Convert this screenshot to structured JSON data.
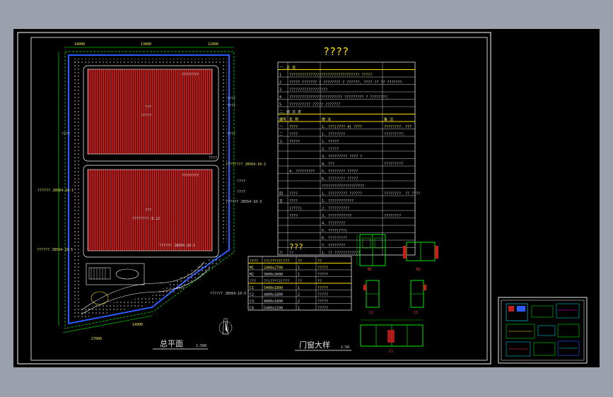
{
  "drawing": {
    "main_title": "????",
    "site_plan_title": "总平面",
    "site_plan_scale": "1:500",
    "door_title": "门窗大样",
    "door_scale": "1:50",
    "door_table_title": "???",
    "building1_label": "???",
    "building1_sub": "?????",
    "building2_label": "???",
    "building2_sub": "???????? 8.12",
    "building_tag": "????????",
    "ref_labels": [
      "????",
      "????",
      "????",
      "????",
      "????????  J8564-10-2",
      "????",
      "????",
      "?????? J8564-10-3",
      "?????? J8564-10-1",
      "????",
      "????",
      "?????? J8564-10-5",
      "?????? J8564-10-1",
      "?????? J8564-10-5"
    ],
    "top_dims": [
      "14000",
      "13000",
      "12000"
    ],
    "bottom_dims": [
      "27000",
      "14000"
    ]
  },
  "spec_table": {
    "rows": [
      {
        "c0": "一、总 说",
        "c1": "",
        "c2": "",
        "c3": ""
      },
      {
        "c0": "1",
        "c1": "????????????????????????????????? ?????",
        "c2": "",
        "c3": ""
      },
      {
        "c0": "2",
        "c1": "????? ??????? ? ???????? ? ??????, ???? ?? ?? ???????.",
        "c2": "",
        "c3": ""
      },
      {
        "c0": "3",
        "c1": "??????????????????",
        "c2": "",
        "c3": ""
      },
      {
        "c0": "4",
        "c1": "????????????????????????? ????????? ? ????????.",
        "c2": "",
        "c3": ""
      },
      {
        "c0": "5",
        "c1": "?????????? ????? ???????",
        "c2": "",
        "c3": ""
      },
      {
        "c0": "二、做 法 表",
        "c1": "",
        "c2": "",
        "c3": ""
      },
      {
        "c0": "编号",
        "c1": "名 称",
        "c2": "做    法",
        "c3": "备 注"
      },
      {
        "c0": "一",
        "c1": "????",
        "c2": "1. ???(???? 4) ????",
        "c3": "????????. ???"
      },
      {
        "c0": "二",
        "c1": "????",
        "c2": "1. ????????",
        "c3": "?????????."
      },
      {
        "c0": "三",
        "c1": "?????",
        "c2": "1. ?????",
        "c3": ""
      },
      {
        "c0": "",
        "c1": "",
        "c2": "2. ?????",
        "c3": ""
      },
      {
        "c0": "",
        "c1": "",
        "c2": "3. ????????? ???? ?",
        "c3": ""
      },
      {
        "c0": "",
        "c1": "",
        "c2": "4. ???",
        "c3": "?????????"
      },
      {
        "c0": "",
        "c1": "4. ?????????",
        "c2": "5. ????????   ?????",
        "c3": ""
      },
      {
        "c0": "",
        "c1": "",
        "c2": "6. ????????   ?????",
        "c3": ""
      },
      {
        "c0": "",
        "c1": "",
        "c2": "????????????????????",
        "c3": ""
      },
      {
        "c0": "四",
        "c1": "????",
        "c2": "1. ?????????   ??????",
        "c3": "????????. ??  ????"
      },
      {
        "c0": "五",
        "c1": "????",
        "c2": "1. ????????????",
        "c3": ""
      },
      {
        "c0": "",
        "c1": "(????)",
        "c2": "2. ??????????",
        "c3": ""
      },
      {
        "c0": "",
        "c1": "????",
        "c2": "3. ???????????",
        "c3": "????????"
      },
      {
        "c0": "",
        "c1": "",
        "c2": "4. ????????",
        "c3": ""
      },
      {
        "c0": "",
        "c1": "",
        "c2": "5. ????(???)",
        "c3": ""
      },
      {
        "c0": "",
        "c1": "",
        "c2": "6. ?????????",
        "c3": ""
      },
      {
        "c0": "",
        "c1": "",
        "c2": "7. ????????",
        "c3": ""
      },
      {
        "c0": "六",
        "c1": "??",
        "c2": "1. ?? ????????????",
        "c3": ""
      }
    ]
  },
  "door_table": {
    "rows": [
      {
        "c0": "????",
        "c1": "??(??*??)???",
        "c2": "??",
        "c3": "??"
      },
      {
        "c0": "M1",
        "c1": "2400x2700",
        "c2": "1",
        "c3": "?????"
      },
      {
        "c0": "M2",
        "c1": "3000x3000",
        "c2": "1",
        "c3": "?????"
      },
      {
        "c0": "???",
        "c1": "??(??*??)???",
        "c2": "??",
        "c3": "??"
      },
      {
        "c0": "C1",
        "c1": "5400x1800",
        "c2": "1",
        "c3": "?????"
      },
      {
        "c0": "C2",
        "c1": "4800x1800",
        "c2": "2",
        "c3": "?????"
      },
      {
        "c0": "C3",
        "c1": "4800x1800",
        "c2": "2",
        "c3": "?????"
      },
      {
        "c0": "C4",
        "c1": "5400x2100",
        "c2": "1",
        "c3": "?????"
      }
    ]
  },
  "door_details": [
    {
      "name": "door-detail-m1",
      "label": "M1"
    },
    {
      "name": "door-detail-m2",
      "label": "M2"
    },
    {
      "name": "window-detail-c2",
      "label": "C2"
    },
    {
      "name": "window-detail-c3",
      "label": "C3"
    },
    {
      "name": "window-detail-c1",
      "label": "C1"
    }
  ],
  "colors": {
    "background": "#000000",
    "frame": "#ffffff",
    "roof": "#c81e1e",
    "road": "#ffffff",
    "green": "#00ff00",
    "blue": "#2a5cff",
    "yellow": "#ffe100",
    "cyan": "#00e5ff"
  }
}
